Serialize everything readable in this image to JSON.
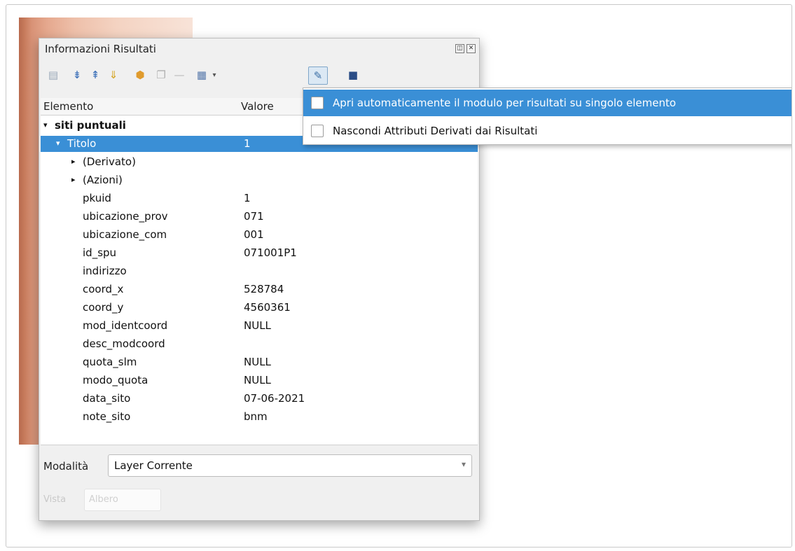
{
  "dialog": {
    "title": "Informazioni Risultati",
    "title_buttons": [
      "float-icon",
      "close-icon"
    ]
  },
  "toolbar": {
    "icons": [
      "expand-tree-icon",
      "collapse-icon",
      "expand-all-icon",
      "collapse-all-icon",
      "clear-results-icon",
      "copy-icon",
      "print-icon",
      "select-mode-icon",
      "settings-icon",
      "help-icon"
    ]
  },
  "tree": {
    "headers": {
      "element": "Elemento",
      "value": "Valore"
    },
    "layer": "siti puntuali",
    "feature": {
      "label": "Titolo",
      "value": "1"
    },
    "groups": [
      "(Derivato)",
      "(Azioni)"
    ],
    "attributes": [
      {
        "name": "pkuid",
        "value": "1"
      },
      {
        "name": "ubicazione_prov",
        "value": "071"
      },
      {
        "name": "ubicazione_com",
        "value": "001"
      },
      {
        "name": "id_spu",
        "value": "071001P1"
      },
      {
        "name": "indirizzo",
        "value": ""
      },
      {
        "name": "coord_x",
        "value": "528784"
      },
      {
        "name": "coord_y",
        "value": "4560361"
      },
      {
        "name": "mod_identcoord",
        "value": "NULL"
      },
      {
        "name": "desc_modcoord",
        "value": ""
      },
      {
        "name": "quota_slm",
        "value": "NULL"
      },
      {
        "name": "modo_quota",
        "value": "NULL"
      },
      {
        "name": "data_sito",
        "value": "07-06-2021"
      },
      {
        "name": "note_sito",
        "value": "bnm"
      }
    ]
  },
  "mode": {
    "label": "Modalità",
    "value": "Layer Corrente"
  },
  "view": {
    "label": "Vista",
    "value": "Albero"
  },
  "menu": {
    "items": [
      {
        "label": "Apri automaticamente il modulo per risultati su singolo elemento",
        "checked": false
      },
      {
        "label": "Nascondi Attributi Derivati dai Risultati",
        "checked": false
      }
    ]
  },
  "colors": {
    "selection": "#3a8fd6",
    "background": "#f0f0f0"
  }
}
